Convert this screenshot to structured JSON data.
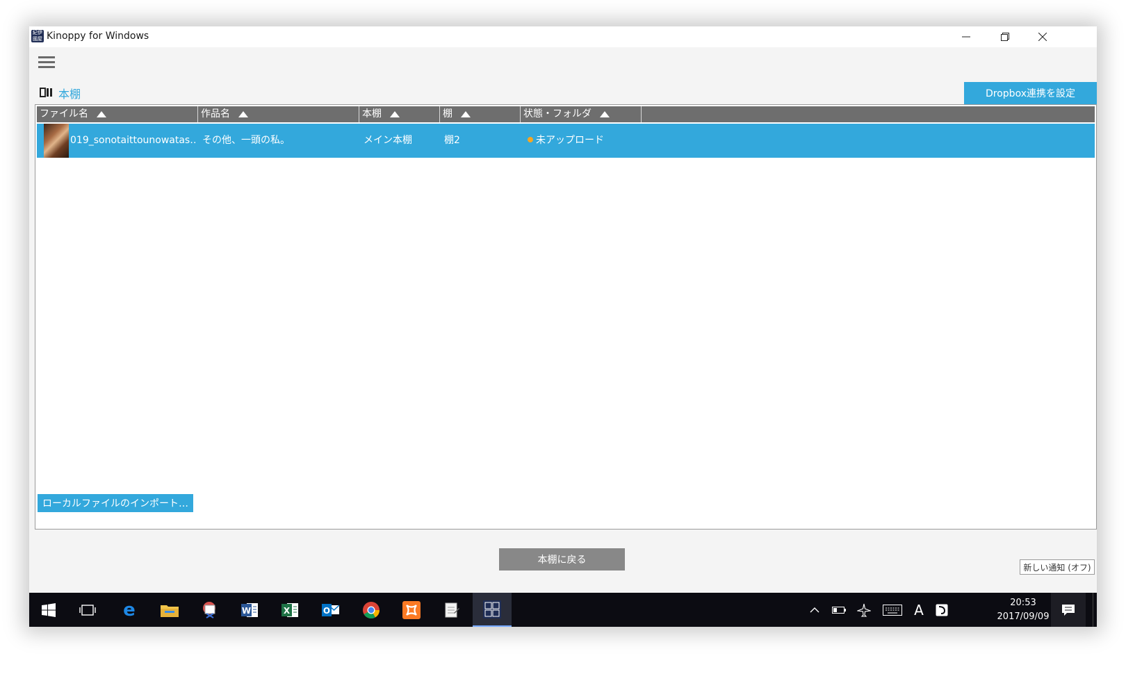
{
  "window": {
    "title": "Kinoppy for Windows",
    "app_icon_text": "紀伊國屋"
  },
  "breadcrumb": {
    "label": "本棚"
  },
  "header": {
    "dropbox_button": "Dropbox連携を設定"
  },
  "table": {
    "columns": [
      {
        "label": "ファイル名",
        "sort": "ascending"
      },
      {
        "label": "作品名",
        "sort": "ascending"
      },
      {
        "label": "本棚",
        "sort": "ascending"
      },
      {
        "label": "棚",
        "sort": "ascending"
      },
      {
        "label": "状態・フォルダ",
        "sort": "ascending"
      }
    ],
    "rows": [
      {
        "filename": "019_sonotaittounowatas‥",
        "title": "その他、一頭の私。",
        "bookshelf": "メイン本棚",
        "shelf": "棚2",
        "status": "未アップロード",
        "status_color": "#f5a623",
        "selected": true
      }
    ]
  },
  "footer": {
    "import_button": "ローカルファイルのインポート…",
    "back_button": "本棚に戻る",
    "notification_tooltip": "新しい通知 (オフ)"
  },
  "taskbar": {
    "apps": [
      "start-icon",
      "task-view-icon",
      "edge-icon",
      "file-explorer-icon",
      "snipping-tool-icon",
      "word-icon",
      "excel-icon",
      "outlook-icon",
      "chrome-icon",
      "xampp-icon",
      "notepad-icon",
      "kinoppy-icon"
    ],
    "active_app": "kinoppy-icon",
    "ime_indicator": "A",
    "time": "20:53",
    "date": "2017/09/09"
  },
  "colors": {
    "accent": "#33a8dc",
    "header_bg": "#6e6e6e",
    "taskbar_bg": "#0c0c12"
  }
}
